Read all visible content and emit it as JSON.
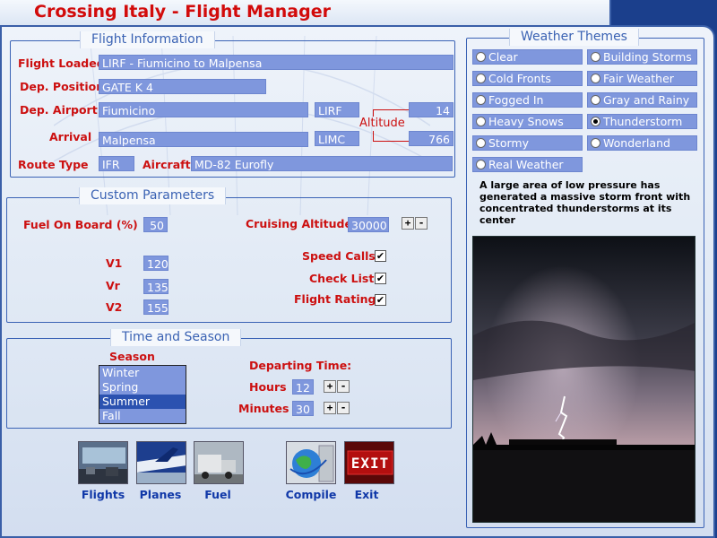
{
  "app": {
    "title": "Crossing Italy - Flight Manager"
  },
  "flight_info": {
    "section_title": "Flight Information",
    "flight_loaded_label": "Flight Loaded",
    "flight_loaded_value": "LIRF - Fiumicino to Malpensa",
    "dep_position_label": "Dep. Position",
    "dep_position_value": "GATE K 4",
    "dep_airport_label": "Dep. Airport",
    "dep_airport_name": "Fiumicino",
    "dep_airport_code": "LIRF",
    "dep_altitude": "14",
    "altitude_label": "Altitude",
    "arrival_label": "Arrival",
    "arrival_name": "Malpensa",
    "arrival_code": "LIMC",
    "arrival_altitude": "766",
    "route_type_label": "Route Type",
    "route_type_value": "IFR",
    "aircraft_label": "Aircraft",
    "aircraft_value": "MD-82 Eurofly"
  },
  "custom": {
    "section_title": "Custom Parameters",
    "fuel_label": "Fuel On Board (%)",
    "fuel_value": "50",
    "cruise_label": "Cruising Altitude",
    "cruise_value": "30000",
    "v1_label": "V1",
    "v1_value": "120",
    "vr_label": "Vr",
    "vr_value": "135",
    "v2_label": "V2",
    "v2_value": "155",
    "speed_calls_label": "Speed Calls",
    "speed_calls_checked": true,
    "check_list_label": "Check List",
    "check_list_checked": true,
    "flight_rating_label": "Flight Rating",
    "flight_rating_checked": true,
    "plus": "+",
    "minus": "-"
  },
  "time_season": {
    "section_title": "Time and Season",
    "season_label": "Season",
    "seasons": [
      "Winter",
      "Spring",
      "Summer",
      "Fall"
    ],
    "selected_season": "Summer",
    "departing_label": "Departing Time:",
    "hours_label": "Hours",
    "hours_value": "12",
    "minutes_label": "Minutes",
    "minutes_value": "30"
  },
  "weather": {
    "section_title": "Weather Themes",
    "options": [
      {
        "label": "Clear",
        "selected": false
      },
      {
        "label": "Building Storms",
        "selected": false
      },
      {
        "label": "Cold Fronts",
        "selected": false
      },
      {
        "label": "Fair Weather",
        "selected": false
      },
      {
        "label": "Fogged In",
        "selected": false
      },
      {
        "label": "Gray and Rainy",
        "selected": false
      },
      {
        "label": "Heavy Snows",
        "selected": false
      },
      {
        "label": "Thunderstorm",
        "selected": true
      },
      {
        "label": "Stormy",
        "selected": false
      },
      {
        "label": "Wonderland",
        "selected": false
      },
      {
        "label": "Real Weather",
        "selected": false
      }
    ],
    "description": "A large area of low pressure has generated a massive storm front with concentrated thunderstorms at its center"
  },
  "toolbar": {
    "flights": "Flights",
    "planes": "Planes",
    "fuel": "Fuel",
    "compile": "Compile",
    "exit": "Exit",
    "exit_sign_text": "EXIT"
  },
  "colors": {
    "label_red": "#cc1010",
    "field_blue": "#7f97dd",
    "title_blue": "#3a62b3",
    "toolbar_text": "#1038a8"
  }
}
